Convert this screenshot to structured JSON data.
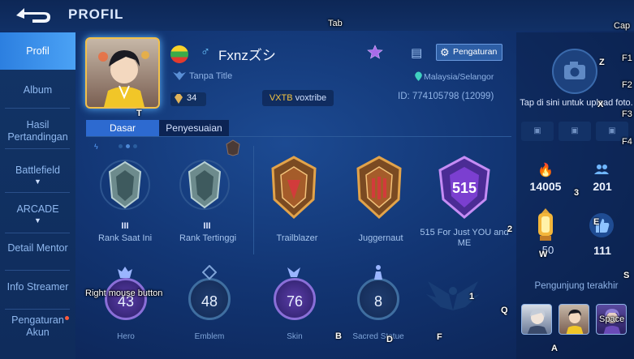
{
  "header": {
    "title": "PROFIL",
    "back_icon": "back-arrow-icon"
  },
  "sidebar": {
    "items": [
      {
        "label": "Profil",
        "active": true
      },
      {
        "label": "Album"
      },
      {
        "label": "Hasil Pertandingan"
      },
      {
        "label": "Battlefield",
        "chevron": true
      },
      {
        "label": "ARCADE",
        "chevron": true
      },
      {
        "label": "Detail Mentor"
      },
      {
        "label": "Info Streamer"
      },
      {
        "label": "Pengaturan Akun",
        "notification": true
      }
    ]
  },
  "profile": {
    "name": "Fxnzズシ",
    "gender_symbol": "♂",
    "title": "Tanpa Title",
    "gems": "34",
    "squad_tag": "VXTB",
    "squad_name": "voxtribe",
    "location": "Malaysia/Selangor",
    "id_text": "ID: 774105798 (12099)",
    "settings_label": "Pengaturan"
  },
  "tabs": [
    {
      "label": "Dasar",
      "active": true
    },
    {
      "label": "Penyesuaian"
    }
  ],
  "badges": [
    {
      "label": "Rank Saat Ini",
      "roman": "III"
    },
    {
      "label": "Rank Tertinggi",
      "roman": "III"
    },
    {
      "label": "Trailblazer"
    },
    {
      "label": "Juggernaut"
    },
    {
      "label": "515 For Just YOU and ME",
      "emblem_text": "515"
    }
  ],
  "stats": [
    {
      "label": "Hero",
      "value": "43"
    },
    {
      "label": "Emblem",
      "value": "48"
    },
    {
      "label": "Skin",
      "value": "76"
    },
    {
      "label": "Sacred Statue",
      "value": "8"
    }
  ],
  "right_panel": {
    "upload_text": "Tap di sini untuk upload foto.",
    "popularity": "14005",
    "followers": "201",
    "lantern_count": "50",
    "likes": "111",
    "visitors_label": "Pengunjung terakhir"
  },
  "overlay_labels": {
    "tab": "Tab",
    "cap": "Cap",
    "f1": "F1",
    "f2": "F2",
    "f3": "F3",
    "f4": "F4",
    "z": "Z",
    "x": "X",
    "t": "T",
    "two": "2",
    "three": "3",
    "e": "E",
    "w": "W",
    "s": "S",
    "one": "1",
    "q": "Q",
    "b": "B",
    "d": "D",
    "f": "F",
    "a": "A",
    "space": "Space",
    "rmb": "Right mouse button"
  },
  "colors": {
    "accent": "#2d6ad0",
    "gold": "#f3c441",
    "bg": "#123573"
  }
}
